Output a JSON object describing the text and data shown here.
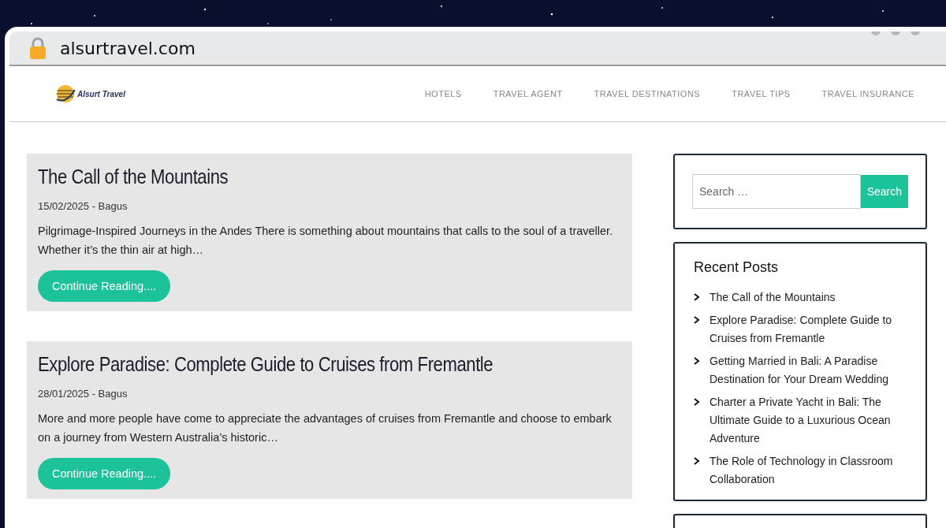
{
  "browser": {
    "url": "alsurtravel.com"
  },
  "site": {
    "logo_text": "Alsurt Travel",
    "nav": [
      "HOTELS",
      "TRAVEL AGENT",
      "TRAVEL DESTINATIONS",
      "TRAVEL TIPS",
      "TRAVEL INSURANCE"
    ]
  },
  "posts": [
    {
      "title": "The Call of the Mountains",
      "meta": "15/02/2025 - Bagus",
      "excerpt": "Pilgrimage-Inspired Journeys in the Andes There is something about mountains that calls to the soul of a traveller. Whether it’s the thin air at high…",
      "button": "Continue Reading...."
    },
    {
      "title": "Explore Paradise: Complete Guide to Cruises from Fremantle",
      "meta": "28/01/2025 - Bagus",
      "excerpt": "More and more people have come to appreciate the advantages of cruises from Fremantle and choose to embark on a journey from Western Australia’s historic…",
      "button": "Continue Reading...."
    }
  ],
  "sidebar": {
    "search": {
      "placeholder": "Search …",
      "button": "Search"
    },
    "recent_posts": {
      "title": "Recent Posts",
      "items": [
        "The Call of the Mountains",
        "Explore Paradise: Complete Guide to Cruises from Fremantle",
        "Getting Married in Bali: A Paradise Destination for Your Dream Wedding",
        "Charter a Private Yacht in Bali: The Ultimate Guide to a Luxurious Ocean Adventure",
        "The Role of Technology in Classroom Collaboration"
      ]
    }
  }
}
